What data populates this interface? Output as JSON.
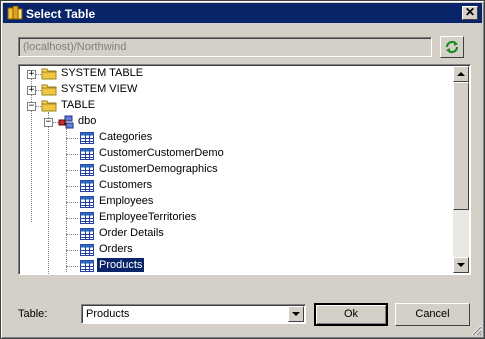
{
  "window": {
    "title": "Select Table",
    "close_label": "✕"
  },
  "server": {
    "value": "(localhost)/Northwind"
  },
  "tree": {
    "groups": [
      {
        "label": "SYSTEM TABLE",
        "expander": "+"
      },
      {
        "label": "SYSTEM VIEW",
        "expander": "+"
      },
      {
        "label": "TABLE",
        "expander": "−"
      }
    ],
    "schema": {
      "label": "dbo",
      "expander": "−"
    },
    "tables": [
      "Categories",
      "CustomerCustomerDemo",
      "CustomerDemographics",
      "Customers",
      "Employees",
      "EmployeeTerritories",
      "Order Details",
      "Orders",
      "Products"
    ],
    "selected": "Products"
  },
  "footer": {
    "table_label": "Table:",
    "table_value": "Products",
    "ok_label": "Ok",
    "cancel_label": "Cancel"
  },
  "colors": {
    "titlebar": "#0a246a",
    "selection": "#0a246a",
    "face": "#d4d0c8"
  }
}
